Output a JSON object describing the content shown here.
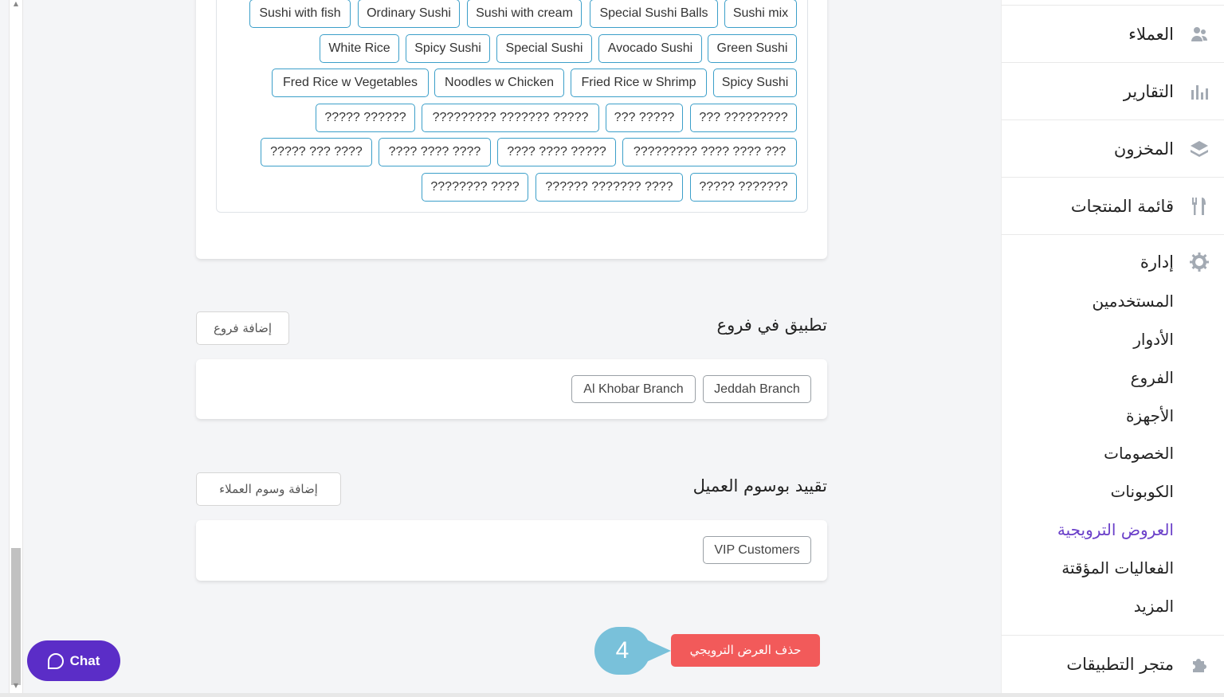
{
  "products": {
    "chips": [
      [
        "Sushi with fish",
        "Ordinary Sushi",
        "Sushi with cream",
        "Special Sushi Balls",
        "Sushi mix"
      ],
      [
        "White Rice",
        "Spicy Sushi",
        "Special Sushi",
        "Avocado Sushi",
        "Green Sushi"
      ],
      [
        "Fred Rice w Vegetables",
        "Noodles w Chicken",
        "Fried Rice w Shrimp",
        "Spicy Sushi"
      ],
      [
        "????? ??????",
        "????????? ??????? ?????",
        "??? ?????",
        "??? ?????????"
      ],
      [
        "????? ??? ????",
        "???? ???? ????",
        "???? ???? ?????",
        "????????? ???? ???? ???"
      ],
      [
        "???????? ????",
        "?????? ??????? ????",
        "????? ???????"
      ]
    ]
  },
  "branches": {
    "title": "تطبيق في فروع",
    "add_button": "إضافة فروع",
    "items": [
      "Al Khobar Branch",
      "Jeddah Branch"
    ]
  },
  "customer_tags": {
    "title": "تقييد بوسوم العميل",
    "add_button": "إضافة وسوم العملاء",
    "items": [
      "VIP Customers"
    ]
  },
  "actions": {
    "delete_label": "حذف العرض الترويجي",
    "step_number": "4"
  },
  "chat": {
    "label": "Chat"
  },
  "sidebar": {
    "items": [
      {
        "label": "العملاء",
        "icon": "customers-icon"
      },
      {
        "label": "التقارير",
        "icon": "reports-icon"
      },
      {
        "label": "المخزون",
        "icon": "inventory-icon"
      },
      {
        "label": "قائمة المنتجات",
        "icon": "menu-icon"
      }
    ],
    "admin": {
      "label": "إدارة",
      "icon": "gear-icon",
      "sub_items": [
        "المستخدمين",
        "الأدوار",
        "الفروع",
        "الأجهزة",
        "الخصومات",
        "الكوبونات",
        "العروض الترويجية",
        "الفعاليات المؤقتة",
        "المزيد"
      ],
      "active": "العروض الترويجية"
    },
    "store": {
      "label": "متجر التطبيقات",
      "icon": "puzzle-icon"
    }
  },
  "colors": {
    "accent": "#6a3fc9",
    "chip_border": "#3c9fc9",
    "danger": "#f25a5a",
    "chat": "#5b2dc7",
    "step_badge": "#79c1da"
  }
}
